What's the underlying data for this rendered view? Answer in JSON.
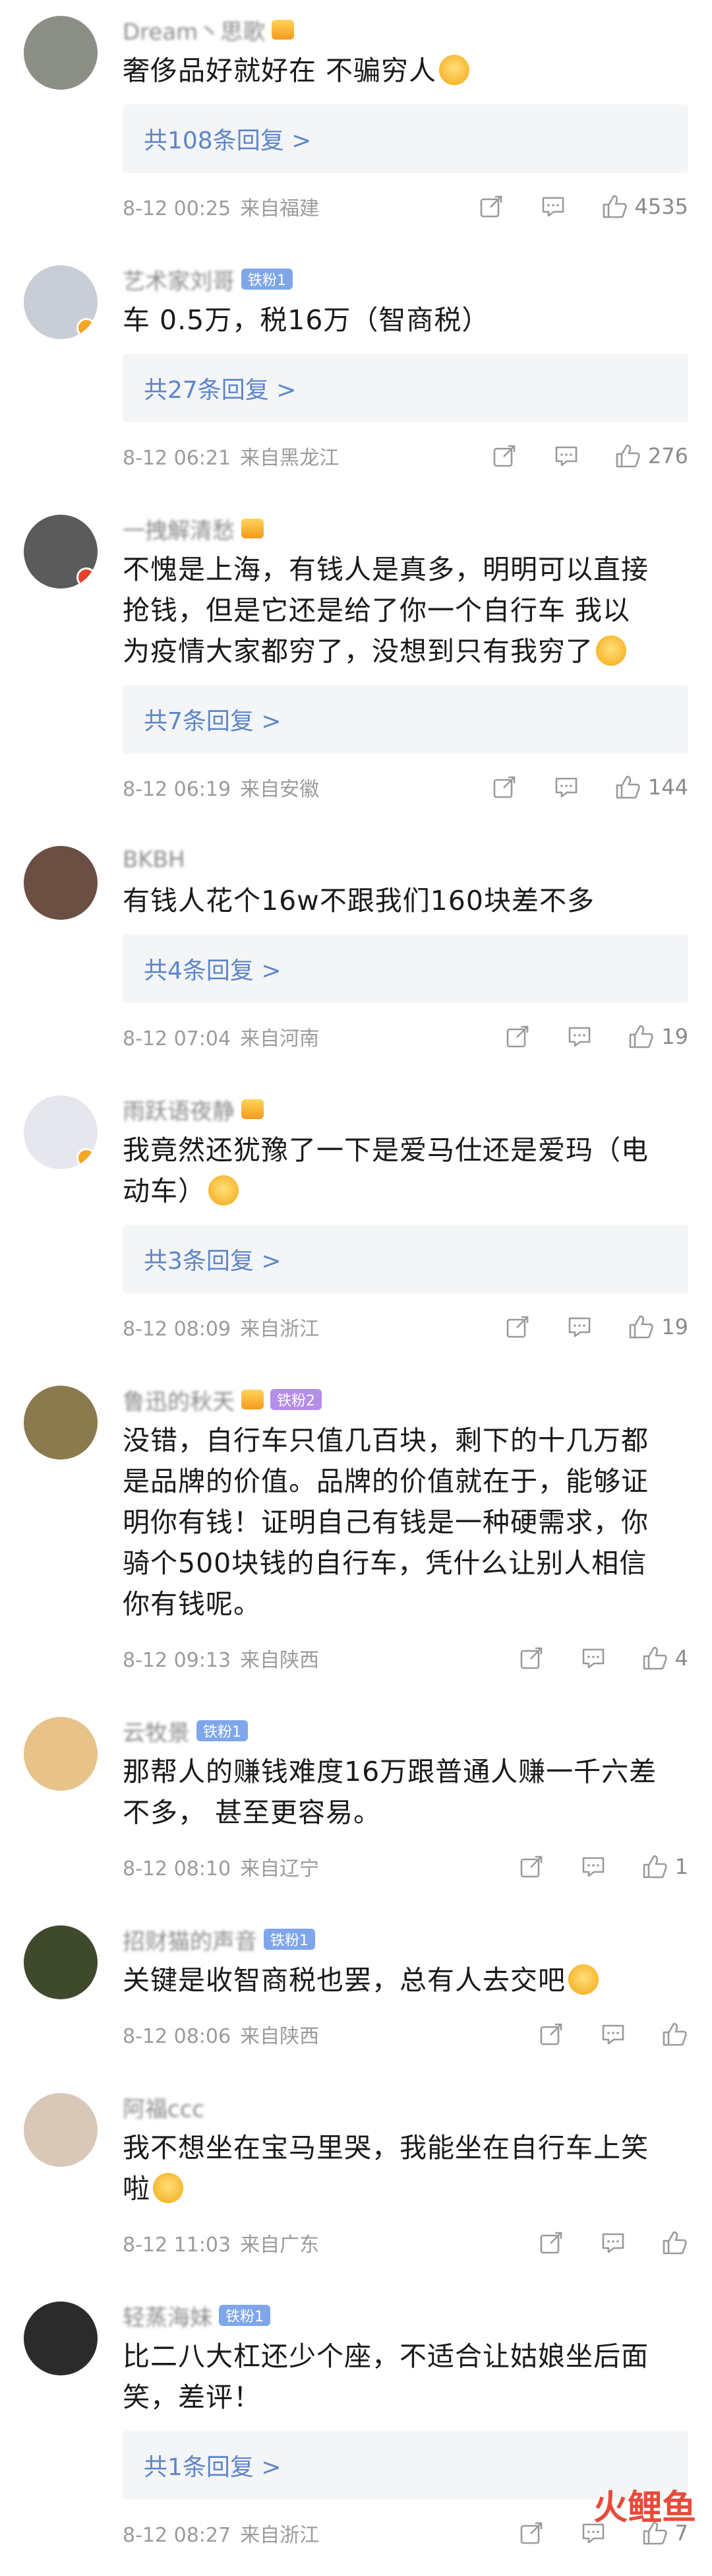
{
  "comments": [
    {
      "name": "Dream丶思歌",
      "name_badge": "crown",
      "fan_badge": "",
      "avatar_color": "#8b8f86",
      "avatar_badge": "",
      "lines": [
        "奢侈品好就好在 不骗穷人"
      ],
      "emoji_after": true,
      "replies": "共108条回复 >",
      "date": "8-12 00:25",
      "location": "来自福建",
      "likes": "4535"
    },
    {
      "name": "艺术家刘哥",
      "name_badge": "",
      "fan_badge": "铁粉1",
      "avatar_color": "#c9cdd6",
      "avatar_badge": "orange",
      "lines": [
        "车 0.5万，税16万（智商税）"
      ],
      "emoji_after": false,
      "replies": "共27条回复 >",
      "date": "8-12 06:21",
      "location": "来自黑龙江",
      "likes": "276"
    },
    {
      "name": "一拽解清愁",
      "name_badge": "crown",
      "fan_badge": "",
      "avatar_color": "#5b5b5b",
      "avatar_badge": "red",
      "lines": [
        "不愧是上海，有钱人是真多，明明可以直接",
        "抢钱，但是它还是给了你一个自行车 我以",
        "为疫情大家都穷了，没想到只有我穷了"
      ],
      "emoji_after": true,
      "replies": "共7条回复 >",
      "date": "8-12 06:19",
      "location": "来自安徽",
      "likes": "144"
    },
    {
      "name": "BKBH",
      "name_badge": "",
      "fan_badge": "",
      "avatar_color": "#6b4f43",
      "avatar_badge": "",
      "lines": [
        "有钱人花个16w不跟我们160块差不多"
      ],
      "emoji_after": false,
      "replies": "共4条回复 >",
      "date": "8-12 07:04",
      "location": "来自河南",
      "likes": "19"
    },
    {
      "name": "雨跃语夜静",
      "name_badge": "crown",
      "fan_badge": "",
      "avatar_color": "#e6e6ee",
      "avatar_badge": "orange",
      "lines": [
        "我竟然还犹豫了一下是爱马仕还是爱玛（电",
        "动车）"
      ],
      "emoji_after": true,
      "replies": "共3条回复 >",
      "date": "8-12 08:09",
      "location": "来自浙江",
      "likes": "19"
    },
    {
      "name": "鲁迅的秋天",
      "name_badge": "crown",
      "fan_badge": "铁粉2",
      "avatar_color": "#8a7a4d",
      "avatar_badge": "",
      "lines": [
        "没错，自行车只值几百块，剩下的十几万都",
        "是品牌的价值。品牌的价值就在于，能够证",
        "明你有钱！证明自己有钱是一种硬需求，你",
        "骑个500块钱的自行车，凭什么让别人相信",
        "你有钱呢。"
      ],
      "emoji_after": false,
      "replies": "",
      "date": "8-12 09:13",
      "location": "来自陕西",
      "likes": "4"
    },
    {
      "name": "云牧景",
      "name_badge": "",
      "fan_badge": "铁粉1",
      "avatar_color": "#e7c38a",
      "avatar_badge": "",
      "lines": [
        "那帮人的赚钱难度16万跟普通人赚一千六差",
        "不多， 甚至更容易。"
      ],
      "emoji_after": false,
      "replies": "",
      "date": "8-12 08:10",
      "location": "来自辽宁",
      "likes": "1"
    },
    {
      "name": "招财猫的声音",
      "name_badge": "",
      "fan_badge": "铁粉1",
      "avatar_color": "#3f4a2d",
      "avatar_badge": "",
      "lines": [
        "关键是收智商税也罢，总有人去交吧"
      ],
      "emoji_after": true,
      "replies": "",
      "date": "8-12 08:06",
      "location": "来自陕西",
      "likes": ""
    },
    {
      "name": "阿福ccc",
      "name_badge": "",
      "fan_badge": "",
      "avatar_color": "#d9c8b8",
      "avatar_badge": "",
      "lines": [
        "我不想坐在宝马里哭，我能坐在自行车上笑",
        "啦"
      ],
      "emoji_after": true,
      "replies": "",
      "date": "8-12 11:03",
      "location": "来自广东",
      "likes": ""
    },
    {
      "name": "轻蒸海妹",
      "name_badge": "",
      "fan_badge": "铁粉1",
      "avatar_color": "#2b2b2b",
      "avatar_badge": "",
      "lines": [
        "比二八大杠还少个座，不适合让姑娘坐后面",
        "笑，差评！"
      ],
      "emoji_after": false,
      "replies": "共1条回复 >",
      "date": "8-12 08:27",
      "location": "来自浙江",
      "likes": "7"
    }
  ],
  "watermark": "火鲤鱼",
  "colors": {
    "link": "#5e86c8",
    "meta": "#9b9b9b",
    "reply_bg": "#f4f5f7"
  }
}
